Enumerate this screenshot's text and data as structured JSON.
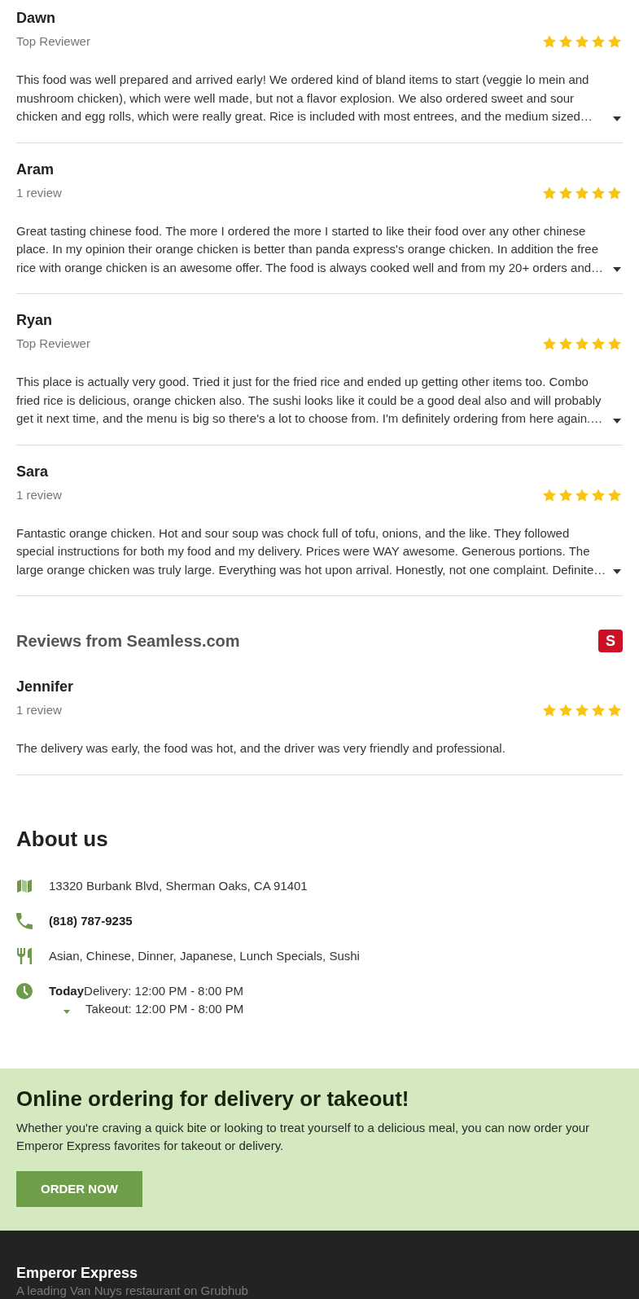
{
  "reviews": [
    {
      "name": "Dawn",
      "badge": "Top Reviewer",
      "stars": 5,
      "text": "This food was well prepared and arrived early! We ordered kind of bland items to start (veggie lo mein and mushroom chicken), which were well made, but not a flavor explosion. We also ordered sweet and sour chicken and egg rolls, which were really great. Rice is included with most entrees, and the medium sized…",
      "expandable": true
    },
    {
      "name": "Aram",
      "badge": "1 review",
      "stars": 5,
      "text": "Great tasting chinese food. The more I ordered the more I started to like their food over any other chinese place. In my opinion their orange chicken is better than panda express's orange chicken. In addition the free rice with orange chicken is an awesome offer. The food is always cooked well and from my 20+ orders and…",
      "expandable": true
    },
    {
      "name": "Ryan",
      "badge": "Top Reviewer",
      "stars": 5,
      "text": "This place is actually very good. Tried it just for the fried rice and ended up getting other items too. Combo fried rice is delicious, orange chicken also. The sushi looks like it could be a good deal also and will probably get it next time, and the menu is big so there's a lot to choose from. I'm definitely ordering from here again.…",
      "expandable": true
    },
    {
      "name": "Sara",
      "badge": "1 review",
      "stars": 5,
      "text": "Fantastic orange chicken. Hot and sour soup was chock full of tofu, onions, and the like. They followed special instructions for both my food and my delivery. Prices were WAY awesome. Generous portions. The large orange chicken was truly large. Everything was hot upon arrival. Honestly, not one complaint. Definite…",
      "expandable": true
    }
  ],
  "seamless": {
    "title": "Reviews from Seamless.com",
    "logo_letter": "S",
    "reviews": [
      {
        "name": "Jennifer",
        "badge": "1 review",
        "stars": 5,
        "text": "The delivery was early, the food was hot, and the driver was very friendly and professional.",
        "expandable": false
      }
    ]
  },
  "about": {
    "title": "About us",
    "items": [
      {
        "kind": "address",
        "text": "13320 Burbank Blvd, Sherman Oaks, CA 91401"
      },
      {
        "kind": "phone",
        "text": "(818) 787-9235"
      },
      {
        "kind": "cuisines",
        "text": "Asian, Chinese, Dinner, Japanese, Lunch Specials, Sushi"
      },
      {
        "kind": "hours",
        "day": "Today",
        "lines": [
          "Delivery: 12:00 PM - 8:00 PM",
          "Takeout: 12:00 PM - 8:00 PM"
        ]
      }
    ]
  },
  "promo": {
    "title": "Online ordering for delivery or takeout!",
    "text": "Whether you're craving a quick bite or looking to treat yourself to a delicious meal, you can now order your Emperor Express favorites for takeout or delivery.",
    "button": "ORDER NOW"
  },
  "footer": {
    "name": "Emperor Express",
    "tagline": "A leading Van Nuys restaurant on Grubhub"
  }
}
